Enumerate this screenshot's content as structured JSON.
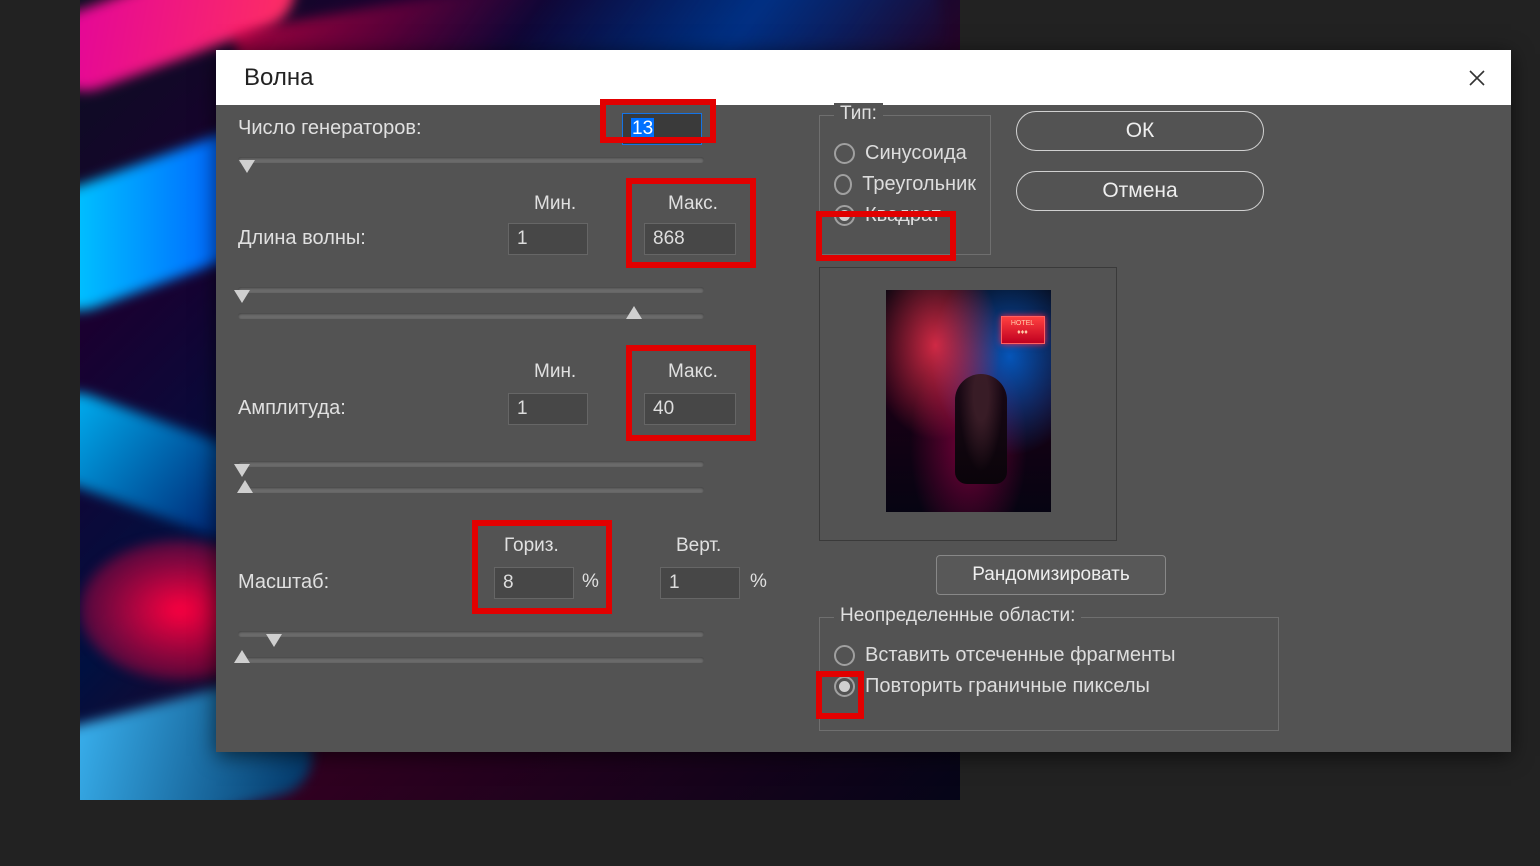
{
  "dialog": {
    "title": "Волна",
    "generators": {
      "label": "Число генераторов:",
      "value": "13"
    },
    "wavelength": {
      "label": "Длина волны:",
      "min_label": "Мин.",
      "max_label": "Макс.",
      "min": "1",
      "max": "868"
    },
    "amplitude": {
      "label": "Амплитуда:",
      "min_label": "Мин.",
      "max_label": "Макс.",
      "min": "1",
      "max": "40"
    },
    "scale": {
      "label": "Масштаб:",
      "horiz_label": "Гориз.",
      "vert_label": "Верт.",
      "horiz": "8",
      "vert": "1",
      "pct": "%"
    },
    "type": {
      "legend": "Тип:",
      "sine": "Синусоида",
      "triangle": "Треугольник",
      "square": "Квадрат",
      "selected": "square"
    },
    "undefined_areas": {
      "legend": "Неопределенные области:",
      "wrap": "Вставить отсеченные фрагменты",
      "repeat": "Повторить граничные пикселы",
      "selected": "repeat"
    },
    "buttons": {
      "ok": "ОК",
      "cancel": "Отмена",
      "randomize": "Рандомизировать"
    }
  }
}
